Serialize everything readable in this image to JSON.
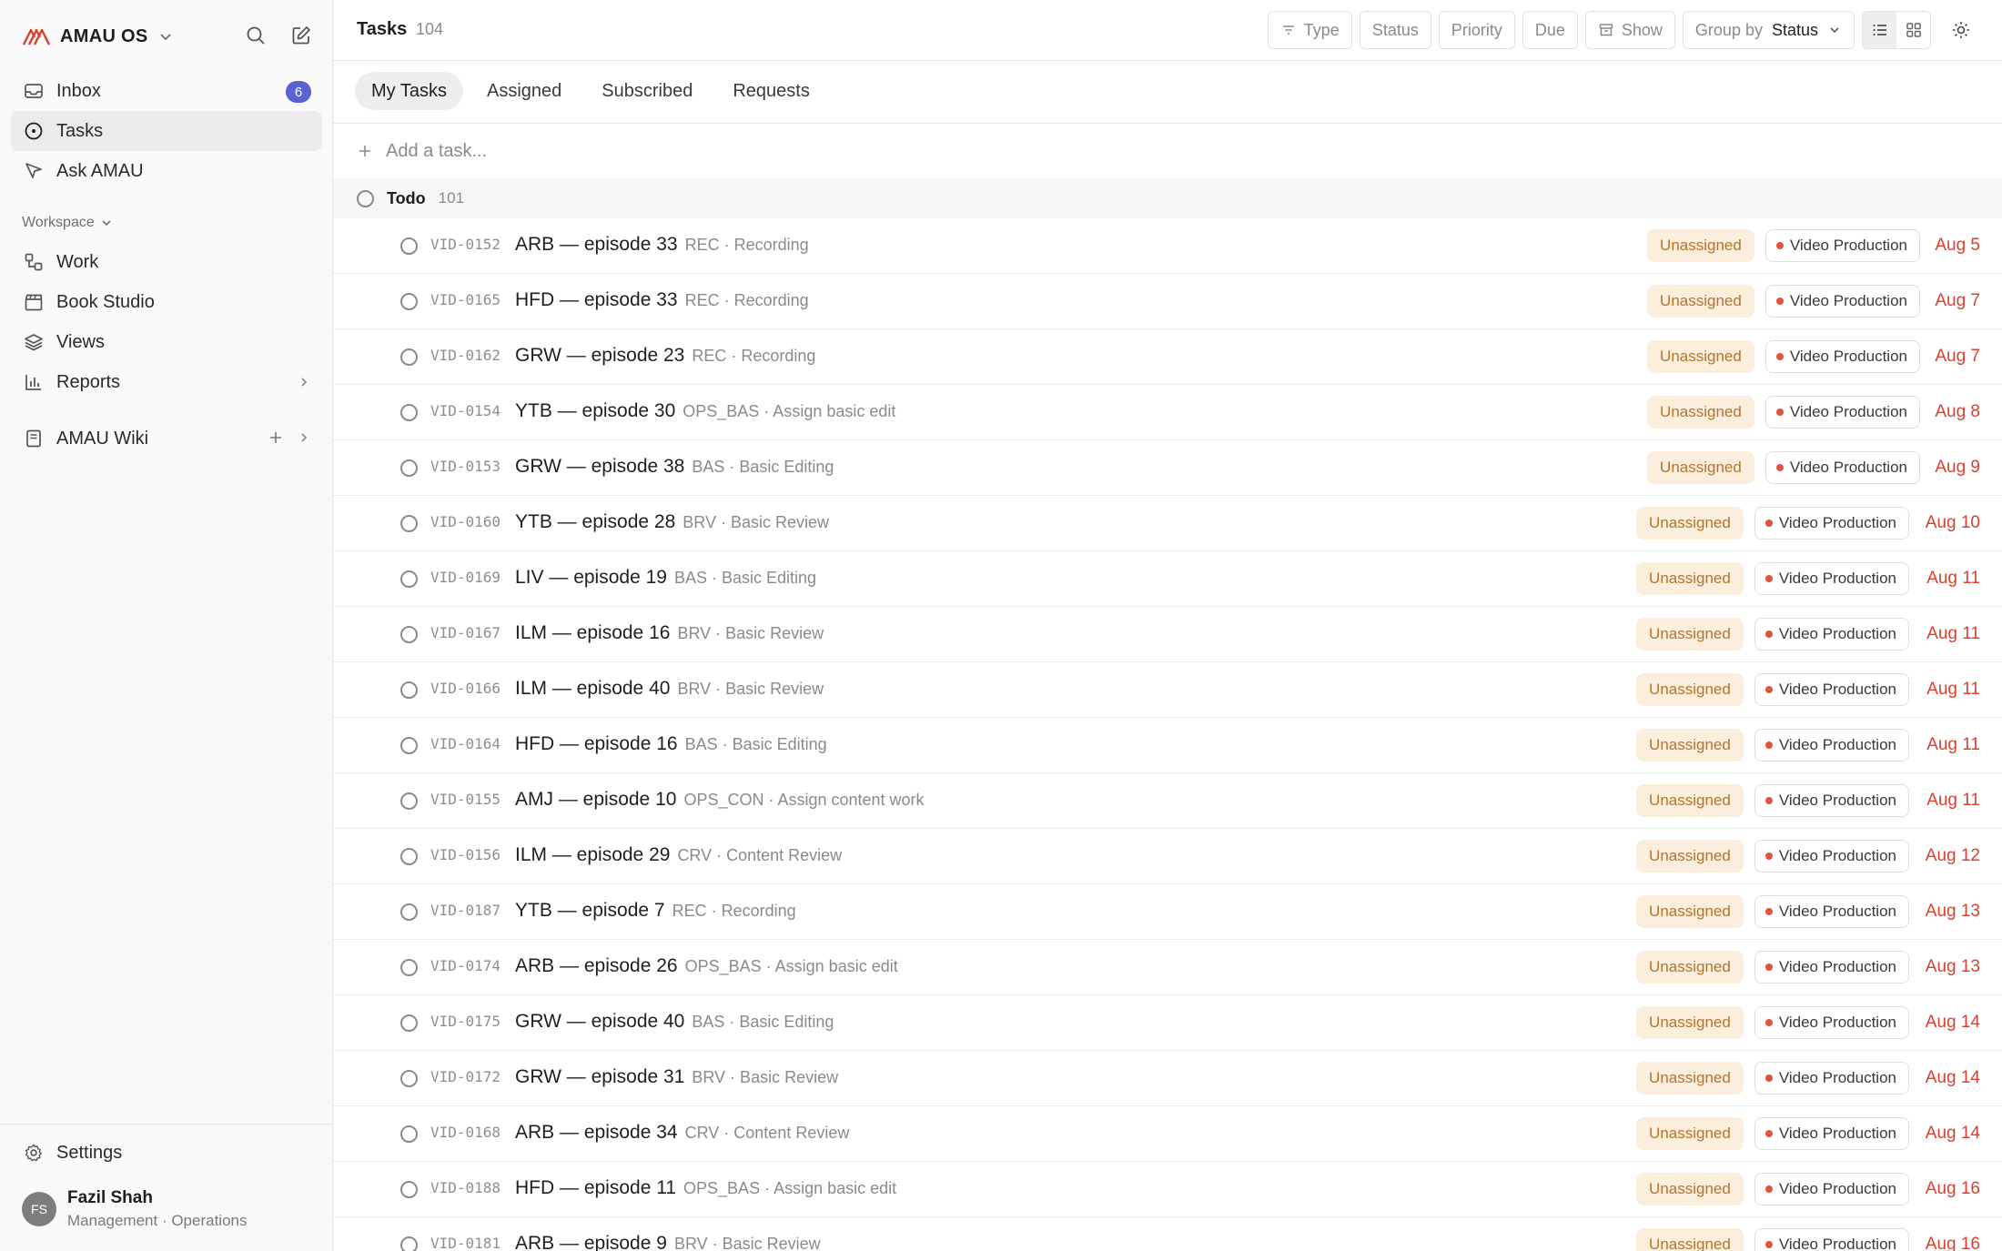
{
  "app": {
    "name": "AMAU OS",
    "accent": "#d9412f",
    "badge_color": "#5b63d3"
  },
  "sidebar": {
    "primary": [
      {
        "label": "Inbox",
        "icon": "inbox-icon",
        "badge": "6"
      },
      {
        "label": "Tasks",
        "icon": "target-icon",
        "active": true
      },
      {
        "label": "Ask AMAU",
        "icon": "send-icon"
      }
    ],
    "section_label": "Workspace",
    "workspace": [
      {
        "label": "Work",
        "icon": "workflow-icon"
      },
      {
        "label": "Book Studio",
        "icon": "clapperboard-icon"
      },
      {
        "label": "Views",
        "icon": "layers-icon"
      },
      {
        "label": "Reports",
        "icon": "bar-chart-icon"
      }
    ],
    "wiki": {
      "label": "AMAU Wiki",
      "icon": "book-icon"
    },
    "settings": {
      "label": "Settings",
      "icon": "gear-icon"
    },
    "user": {
      "initials": "FS",
      "name": "Fazil Shah",
      "role": "Management · Operations"
    }
  },
  "header": {
    "title": "Tasks",
    "count": "104",
    "filters": {
      "type": "Type",
      "status": "Status",
      "priority": "Priority",
      "due": "Due",
      "show": "Show",
      "group_by_label": "Group by",
      "group_by_value": "Status"
    }
  },
  "tabs": [
    "My Tasks",
    "Assigned",
    "Subscribed",
    "Requests"
  ],
  "add_task_placeholder": "Add a task...",
  "group": {
    "title": "Todo",
    "count": "101"
  },
  "tasks": [
    {
      "id": "VID-0152",
      "title": "ARB — episode 33",
      "meta": "REC · Recording",
      "assignee": "Unassigned",
      "project": "Video Production",
      "due": "Aug 5"
    },
    {
      "id": "VID-0165",
      "title": "HFD — episode 33",
      "meta": "REC · Recording",
      "assignee": "Unassigned",
      "project": "Video Production",
      "due": "Aug 7"
    },
    {
      "id": "VID-0162",
      "title": "GRW — episode 23",
      "meta": "REC · Recording",
      "assignee": "Unassigned",
      "project": "Video Production",
      "due": "Aug 7"
    },
    {
      "id": "VID-0154",
      "title": "YTB — episode 30",
      "meta": "OPS_BAS · Assign basic edit",
      "assignee": "Unassigned",
      "project": "Video Production",
      "due": "Aug 8"
    },
    {
      "id": "VID-0153",
      "title": "GRW — episode 38",
      "meta": "BAS · Basic Editing",
      "assignee": "Unassigned",
      "project": "Video Production",
      "due": "Aug 9"
    },
    {
      "id": "VID-0160",
      "title": "YTB — episode 28",
      "meta": "BRV · Basic Review",
      "assignee": "Unassigned",
      "project": "Video Production",
      "due": "Aug 10"
    },
    {
      "id": "VID-0169",
      "title": "LIV — episode 19",
      "meta": "BAS · Basic Editing",
      "assignee": "Unassigned",
      "project": "Video Production",
      "due": "Aug 11"
    },
    {
      "id": "VID-0167",
      "title": "ILM — episode 16",
      "meta": "BRV · Basic Review",
      "assignee": "Unassigned",
      "project": "Video Production",
      "due": "Aug 11"
    },
    {
      "id": "VID-0166",
      "title": "ILM — episode 40",
      "meta": "BRV · Basic Review",
      "assignee": "Unassigned",
      "project": "Video Production",
      "due": "Aug 11"
    },
    {
      "id": "VID-0164",
      "title": "HFD — episode 16",
      "meta": "BAS · Basic Editing",
      "assignee": "Unassigned",
      "project": "Video Production",
      "due": "Aug 11"
    },
    {
      "id": "VID-0155",
      "title": "AMJ — episode 10",
      "meta": "OPS_CON · Assign content work",
      "assignee": "Unassigned",
      "project": "Video Production",
      "due": "Aug 11"
    },
    {
      "id": "VID-0156",
      "title": "ILM — episode 29",
      "meta": "CRV · Content Review",
      "assignee": "Unassigned",
      "project": "Video Production",
      "due": "Aug 12"
    },
    {
      "id": "VID-0187",
      "title": "YTB — episode 7",
      "meta": "REC · Recording",
      "assignee": "Unassigned",
      "project": "Video Production",
      "due": "Aug 13"
    },
    {
      "id": "VID-0174",
      "title": "ARB — episode 26",
      "meta": "OPS_BAS · Assign basic edit",
      "assignee": "Unassigned",
      "project": "Video Production",
      "due": "Aug 13"
    },
    {
      "id": "VID-0175",
      "title": "GRW — episode 40",
      "meta": "BAS · Basic Editing",
      "assignee": "Unassigned",
      "project": "Video Production",
      "due": "Aug 14"
    },
    {
      "id": "VID-0172",
      "title": "GRW — episode 31",
      "meta": "BRV · Basic Review",
      "assignee": "Unassigned",
      "project": "Video Production",
      "due": "Aug 14"
    },
    {
      "id": "VID-0168",
      "title": "ARB — episode 34",
      "meta": "CRV · Content Review",
      "assignee": "Unassigned",
      "project": "Video Production",
      "due": "Aug 14"
    },
    {
      "id": "VID-0188",
      "title": "HFD — episode 11",
      "meta": "OPS_BAS · Assign basic edit",
      "assignee": "Unassigned",
      "project": "Video Production",
      "due": "Aug 16"
    },
    {
      "id": "VID-0181",
      "title": "ARB — episode 9",
      "meta": "BRV · Basic Review",
      "assignee": "Unassigned",
      "project": "Video Production",
      "due": "Aug 16"
    }
  ]
}
